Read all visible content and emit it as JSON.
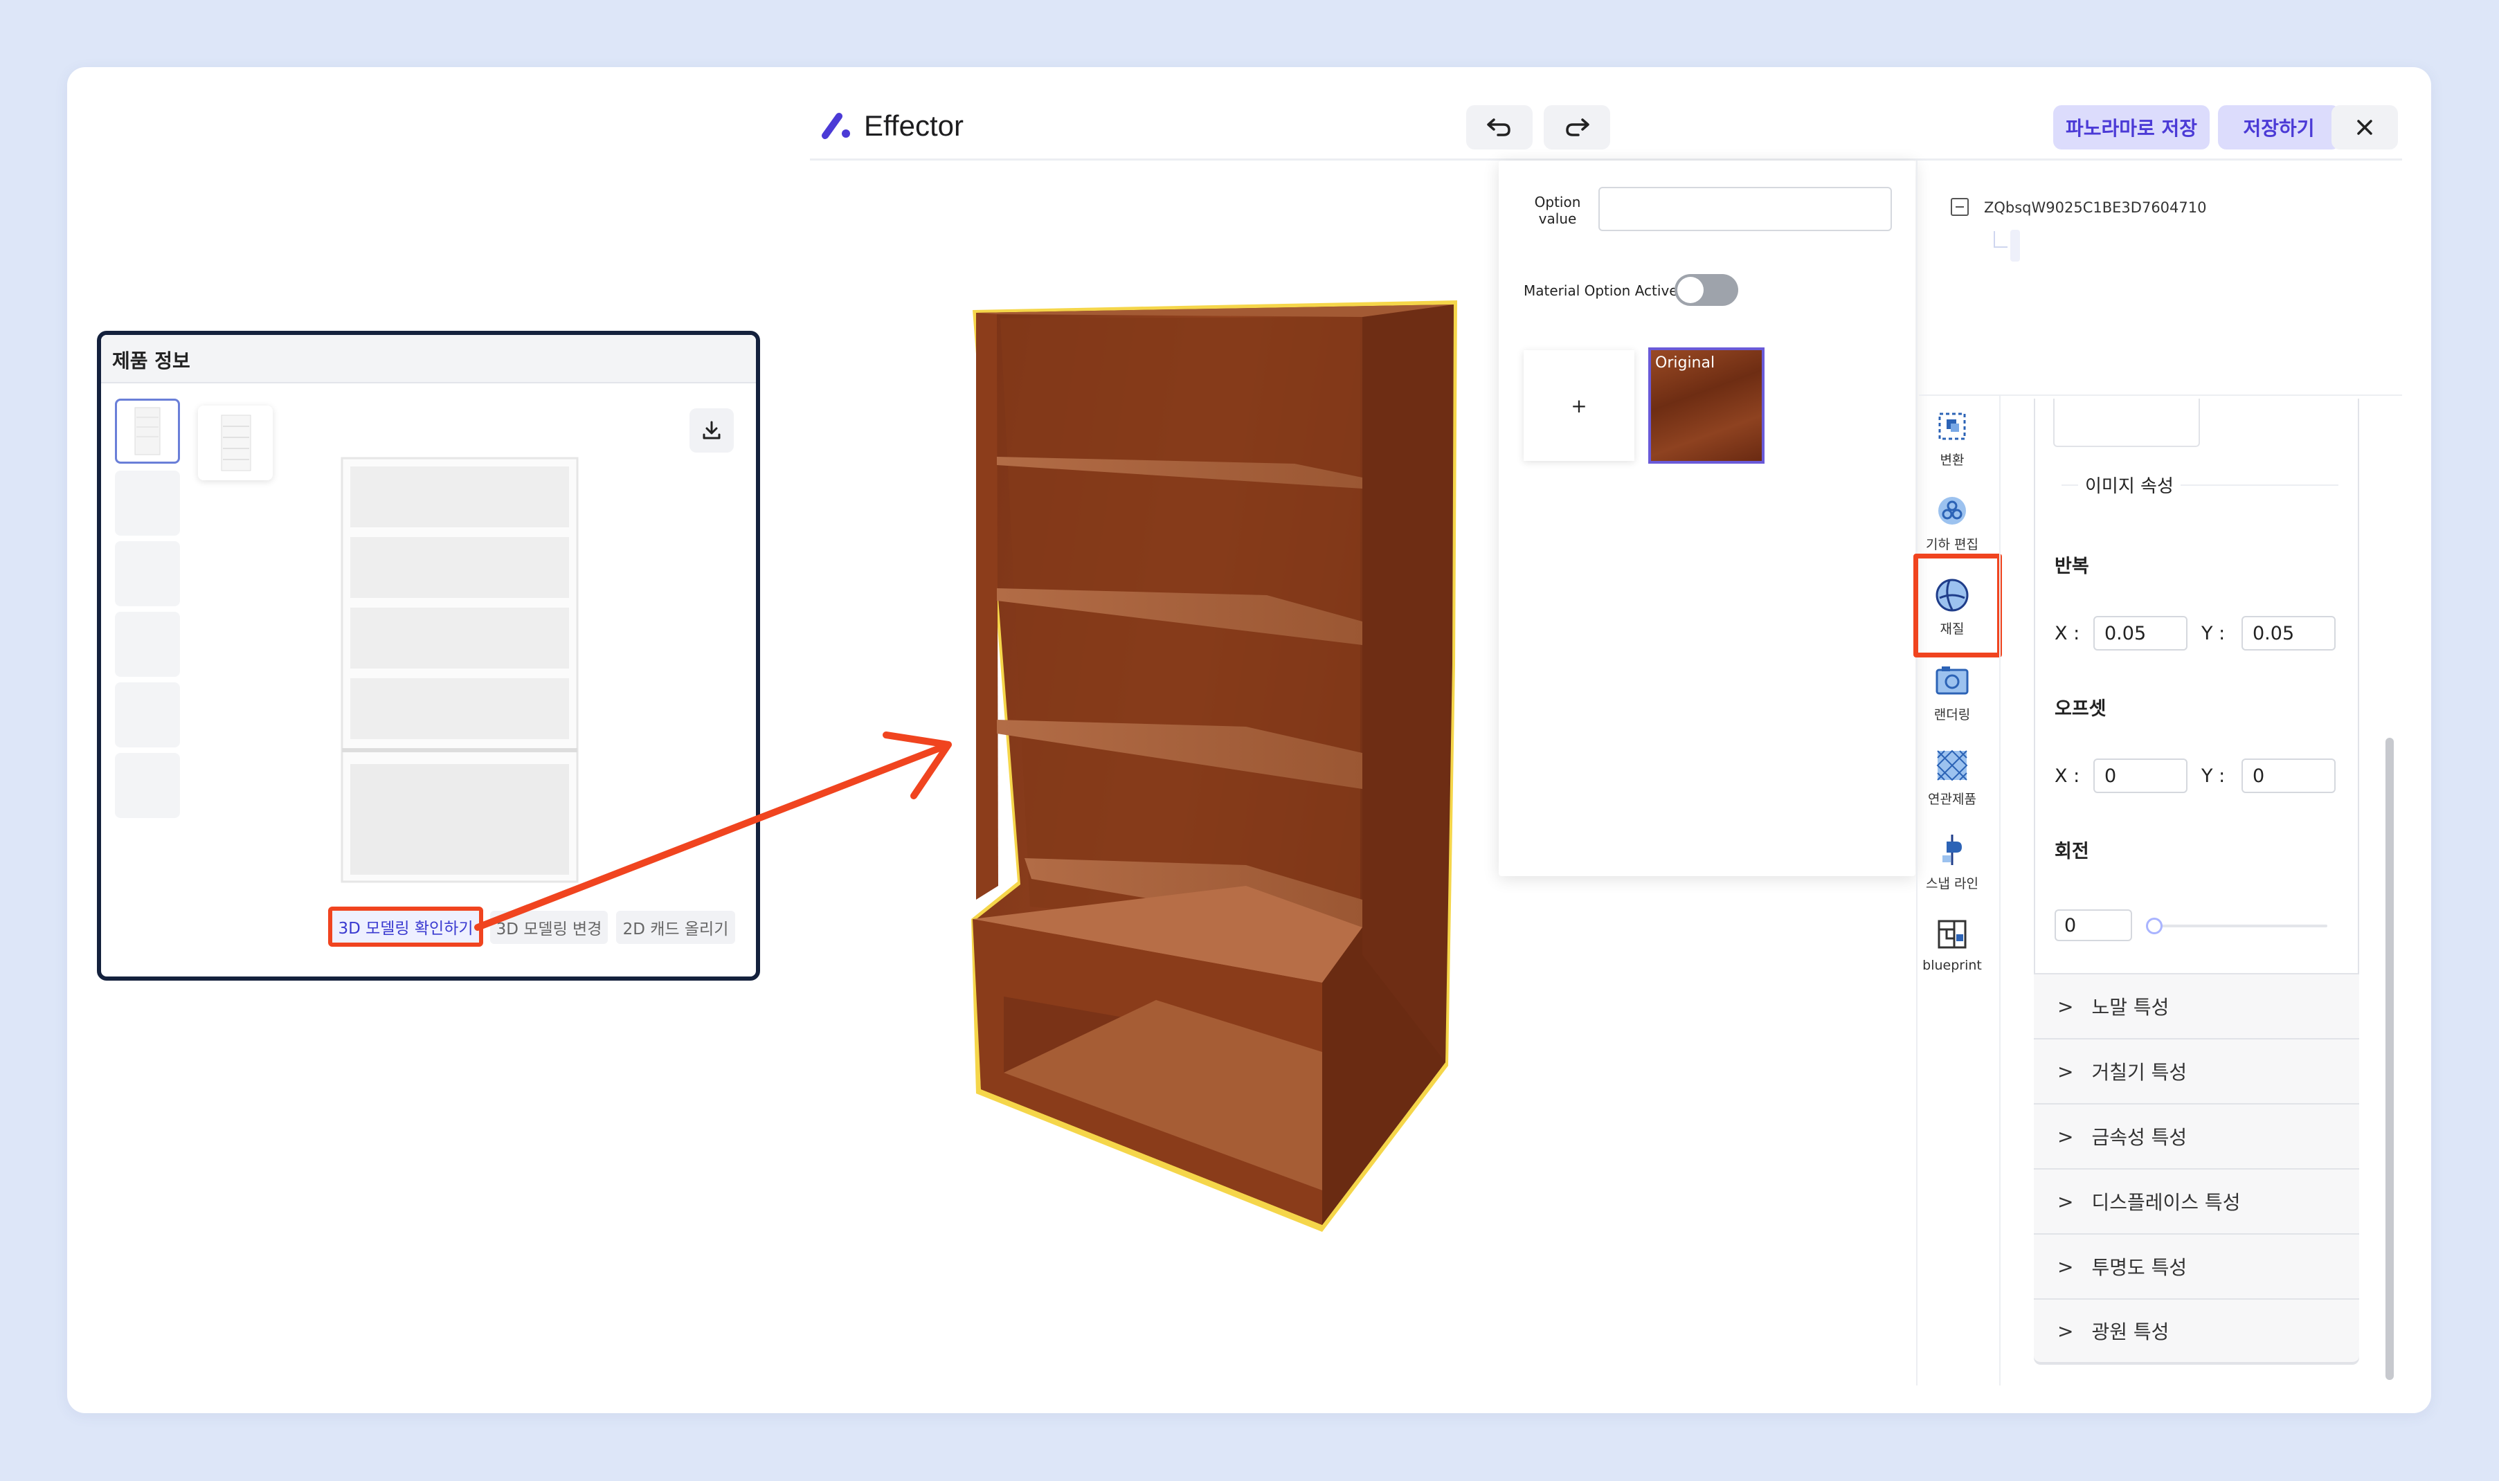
{
  "app": {
    "name": "Effector"
  },
  "header": {
    "undo_icon": "undo-icon",
    "redo_icon": "redo-icon",
    "save_panorama_label": "파노라마로 저장",
    "save_label": "저장하기",
    "close_icon": "close-icon"
  },
  "product_panel": {
    "title": "제품 정보",
    "buttons": [
      "3D 모델링 확인하기",
      "3D 모델링 변경",
      "2D 캐드 올리기"
    ]
  },
  "option_popup": {
    "option_value_label": "Option value",
    "option_value": "",
    "material_option_active_label": "Material Option Active",
    "material_option_active": false,
    "add_label": "+",
    "original_label": "Original"
  },
  "tree": {
    "node_id": "ZQbsqW9025C1BE3D7604710"
  },
  "toolbar": [
    {
      "label": "변환",
      "icon": "transform-icon"
    },
    {
      "label": "기하 편집",
      "icon": "geometry-edit-icon"
    },
    {
      "label": "재질",
      "icon": "material-icon",
      "highlighted": true
    },
    {
      "label": "랜더링",
      "icon": "rendering-camera-icon"
    },
    {
      "label": "연관제품",
      "icon": "related-products-icon"
    },
    {
      "label": "스냅 라인",
      "icon": "snap-line-icon"
    },
    {
      "label": "blueprint",
      "icon": "blueprint-icon"
    }
  ],
  "properties": {
    "image_section_title": "이미지 속성",
    "repeat": {
      "title": "반복",
      "x_label": "X :",
      "x": "0.05",
      "y_label": "Y :",
      "y": "0.05"
    },
    "offset": {
      "title": "오프셋",
      "x_label": "X :",
      "x": "0",
      "y_label": "Y :",
      "y": "0"
    },
    "rotation": {
      "title": "회전",
      "value": "0"
    },
    "sections": [
      "노말 특성",
      "거칠기 특성",
      "금속성 특성",
      "디스플레이스 특성",
      "투명도 특성",
      "광원 특성"
    ]
  },
  "colors": {
    "accent": "#4b3ad6",
    "highlight": "#f0441f",
    "wood": "#8a3c1a",
    "background": "#dde6f8"
  }
}
